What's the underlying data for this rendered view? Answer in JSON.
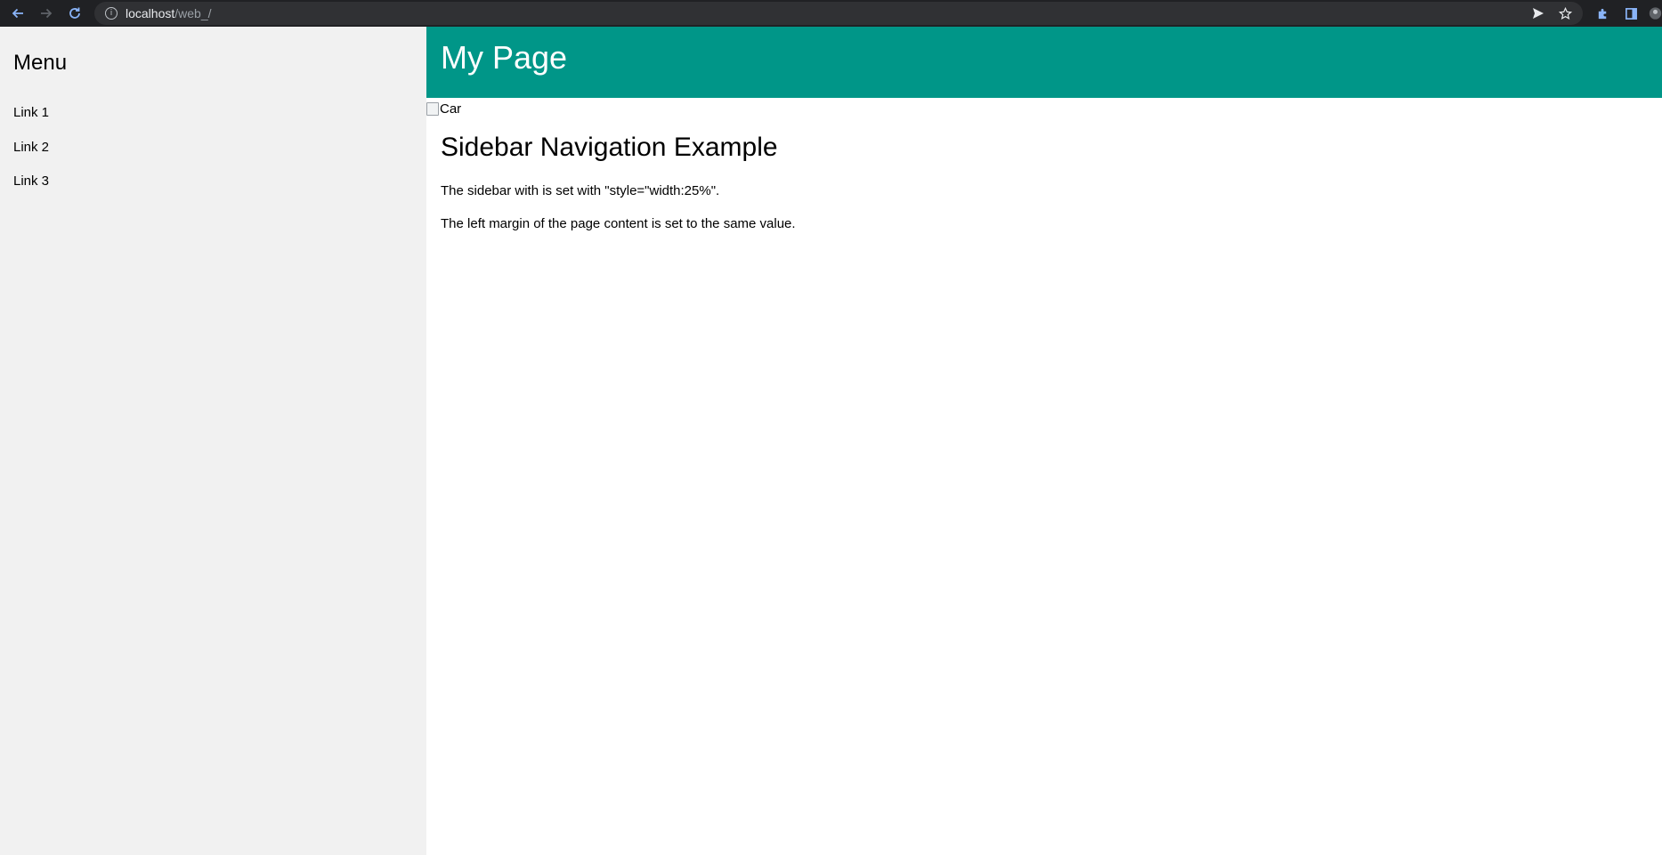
{
  "browser": {
    "url_host": "localhost",
    "url_path": "/web_/"
  },
  "sidebar": {
    "heading": "Menu",
    "links": [
      {
        "label": "Link 1"
      },
      {
        "label": "Link 2"
      },
      {
        "label": "Link 3"
      }
    ],
    "background": "#f1f1f1"
  },
  "header": {
    "title": "My Page",
    "background": "#009688"
  },
  "content": {
    "image_alt": "Car",
    "heading": "Sidebar Navigation Example",
    "paragraphs": [
      "The sidebar with is set with \"style=\"width:25%\".",
      "The left margin of the page content is set to the same value."
    ]
  }
}
